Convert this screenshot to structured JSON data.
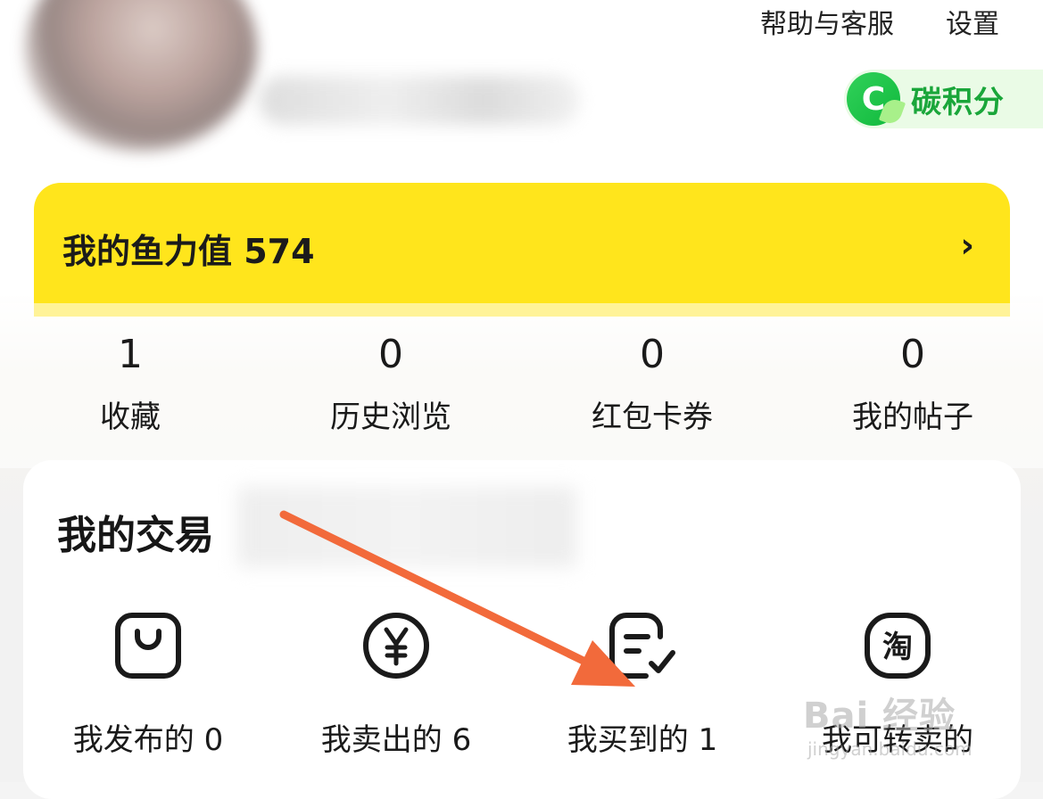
{
  "header": {
    "help_label": "帮助与客服",
    "settings_label": "设置",
    "carbon_icon_letter": "C",
    "carbon_label": "碳积分"
  },
  "fish_card": {
    "label": "我的鱼力值 574",
    "arrow": "›"
  },
  "stats": [
    {
      "value": "1",
      "label": "收藏"
    },
    {
      "value": "0",
      "label": "历史浏览"
    },
    {
      "value": "0",
      "label": "红包卡券"
    },
    {
      "value": "0",
      "label": "我的帖子"
    }
  ],
  "trade": {
    "title": "我的交易",
    "items": [
      {
        "label": "我发布的 0",
        "icon": "shopping-bag-icon"
      },
      {
        "label": "我卖出的 6",
        "icon": "yen-coin-icon"
      },
      {
        "label": "我买到的 1",
        "icon": "order-check-icon"
      },
      {
        "label": "我可转卖的",
        "icon": "taobao-icon",
        "icon_text": "淘"
      }
    ]
  },
  "watermark": {
    "text": "Bai 经验",
    "sub": "jingyan.baidu.com"
  },
  "colors": {
    "fish_card_bg": "#ffe51c",
    "carbon_green": "#1aa63a",
    "annotation_arrow": "#f26a3b"
  }
}
